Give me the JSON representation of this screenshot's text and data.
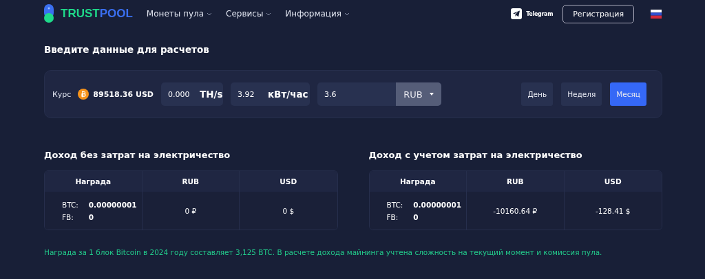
{
  "header": {
    "logo": {
      "first": "TRUST",
      "second": "POOL"
    },
    "nav": [
      {
        "label": "Монеты пула"
      },
      {
        "label": "Сервисы"
      },
      {
        "label": "Информация"
      }
    ],
    "telegram": "Telegram",
    "register": "Регистрация"
  },
  "title": "Введите данные для расчетов",
  "calc": {
    "rate_label": "Курс",
    "rate": "89518.36 USD",
    "hashrate": {
      "value": "0.000",
      "unit": "TH/s"
    },
    "power": {
      "value": "3.92",
      "unit": "кВт/час"
    },
    "price": {
      "value": "3.6",
      "currency": "RUB"
    },
    "periods": [
      {
        "label": "День",
        "selected": false
      },
      {
        "label": "Неделя",
        "selected": false
      },
      {
        "label": "Месяц",
        "selected": true
      }
    ]
  },
  "tables": [
    {
      "title": "Доход без затрат на электричество",
      "columns": [
        "Награда",
        "RUB",
        "USD"
      ],
      "btc_label": "BTC:",
      "btc": "0.00000001",
      "fb_label": "FB:",
      "fb": "0",
      "rub": "0 ₽",
      "usd": "0 $"
    },
    {
      "title": "Доход с учетом затрат на электричество",
      "columns": [
        "Награда",
        "RUB",
        "USD"
      ],
      "btc_label": "BTC:",
      "btc": "0.00000001",
      "fb_label": "FB:",
      "fb": "0",
      "rub": "-10160.64 ₽",
      "usd": "-128.41 $"
    }
  ],
  "note": "Награда за 1 блок Bitcoin в 2024 году составляет 3,125 BTC. В расчете дохода майнинга учтена сложность на текущий момент и комиссия пула."
}
